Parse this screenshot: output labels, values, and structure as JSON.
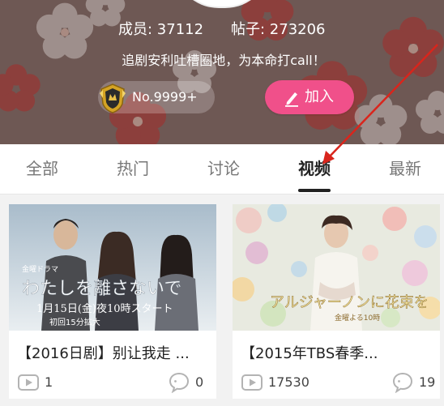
{
  "header": {
    "members_text": "成员: 37112",
    "posts_text": "帖子: 273206",
    "slogan": "追剧安利吐槽圈地，为本命打call！",
    "rank_label": "No.9999+",
    "join_label": "加入",
    "accent": "#f0508a"
  },
  "tabs": [
    {
      "label": "全部",
      "active": false
    },
    {
      "label": "热门",
      "active": false
    },
    {
      "label": "讨论",
      "active": false
    },
    {
      "label": "视频",
      "active": true
    },
    {
      "label": "最新",
      "active": false
    }
  ],
  "cards": [
    {
      "thumb_caption_kana": "わたしを離さないで",
      "thumb_caption_date": "1月15日(金)夜10時スタート",
      "thumb_caption_top": "金曜ドラマ",
      "thumb_caption_sub": "初回15分拡大",
      "title": "【2016日剧】别让我走 ...",
      "views": "1",
      "comments": "0"
    },
    {
      "thumb_caption_kana": "アルジャーノンに花束を",
      "thumb_caption_sub": "金曜よる10時",
      "title": "【2015年TBS春季...",
      "views": "17530",
      "comments": "19"
    }
  ],
  "icons": [
    "avatar",
    "rank-badge-icon",
    "pencil-icon",
    "video-icon",
    "comment-icon",
    "arrow-annotation"
  ]
}
